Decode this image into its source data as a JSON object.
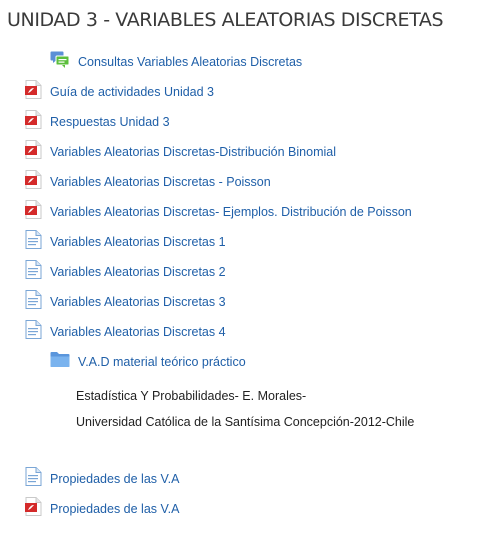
{
  "section": {
    "title": "UNIDAD 3 - VARIABLES ALEATORIAS DISCRETAS"
  },
  "items": [
    {
      "label": "Consultas Variables Aleatorias Discretas",
      "icon": "forum-icon"
    },
    {
      "label": "Guía de actividades Unidad 3",
      "icon": "pdf-icon"
    },
    {
      "label": "Respuestas Unidad 3",
      "icon": "pdf-icon"
    },
    {
      "label": "Variables Aleatorias Discretas-Distribución Binomial",
      "icon": "pdf-icon"
    },
    {
      "label": "Variables Aleatorias Discretas - Poisson",
      "icon": "pdf-icon"
    },
    {
      "label": "Variables Aleatorias Discretas- Ejemplos. Distribución de Poisson",
      "icon": "pdf-icon"
    },
    {
      "label": "Variables Aleatorias Discretas 1",
      "icon": "document-icon"
    },
    {
      "label": "Variables Aleatorias Discretas 2",
      "icon": "document-icon"
    },
    {
      "label": "Variables Aleatorias Discretas 3",
      "icon": "document-icon"
    },
    {
      "label": "Variables Aleatorias Discretas 4",
      "icon": "document-icon"
    },
    {
      "label": "V.A.D material teórico práctico",
      "icon": "folder-icon"
    },
    {
      "label": "Propiedades de las V.A",
      "icon": "document-icon"
    },
    {
      "label": "Propiedades de las V.A",
      "icon": "pdf-icon"
    }
  ],
  "folder_description": {
    "line1": "Estadística Y Probabilidades- E. Morales-",
    "line2": "Universidad Católica de la Santísima Concepción-2012-Chile"
  },
  "colors": {
    "link": "#1f5fa8",
    "pdf_red": "#d42a2a",
    "folder_blue": "#6aa8e6",
    "forum_green": "#5cbf3c",
    "forum_blue": "#5b8fd6"
  }
}
